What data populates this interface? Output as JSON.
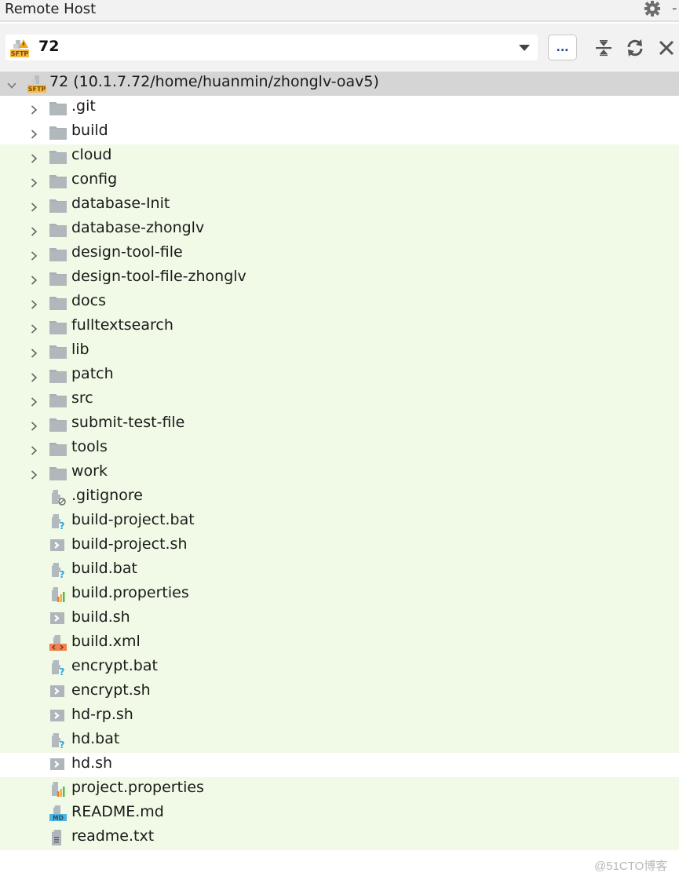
{
  "panel": {
    "title": "Remote Host",
    "settings_icon": "gear-icon",
    "more_icon": "more-icon"
  },
  "toolbar": {
    "connection_value": "72",
    "connection_icon": "sftp-warning-icon",
    "browse_label": "...",
    "collapse_icon": "collapse-all-icon",
    "refresh_icon": "refresh-icon",
    "close_icon": "close-icon"
  },
  "tree": {
    "root": {
      "label": "72 (10.1.7.72/home/huanmin/zhonglv-oav5)",
      "expanded": true,
      "icon": "sftp-icon"
    },
    "items": [
      {
        "label": ".git",
        "type": "folder",
        "icon": "folder-icon",
        "bg": "white"
      },
      {
        "label": "build",
        "type": "folder",
        "icon": "folder-icon",
        "bg": "white"
      },
      {
        "label": "cloud",
        "type": "folder",
        "icon": "folder-icon",
        "bg": "green"
      },
      {
        "label": "config",
        "type": "folder",
        "icon": "folder-icon",
        "bg": "green"
      },
      {
        "label": "database-Init",
        "type": "folder",
        "icon": "folder-icon",
        "bg": "green"
      },
      {
        "label": "database-zhonglv",
        "type": "folder",
        "icon": "folder-icon",
        "bg": "green"
      },
      {
        "label": "design-tool-file",
        "type": "folder",
        "icon": "folder-icon",
        "bg": "green"
      },
      {
        "label": "design-tool-file-zhonglv",
        "type": "folder",
        "icon": "folder-icon",
        "bg": "green"
      },
      {
        "label": "docs",
        "type": "folder",
        "icon": "folder-icon",
        "bg": "green"
      },
      {
        "label": "fulltextsearch",
        "type": "folder",
        "icon": "folder-icon",
        "bg": "green"
      },
      {
        "label": "lib",
        "type": "folder",
        "icon": "folder-icon",
        "bg": "green"
      },
      {
        "label": "patch",
        "type": "folder",
        "icon": "folder-icon",
        "bg": "green"
      },
      {
        "label": "src",
        "type": "folder",
        "icon": "folder-icon",
        "bg": "green"
      },
      {
        "label": "submit-test-file",
        "type": "folder",
        "icon": "folder-icon",
        "bg": "green"
      },
      {
        "label": "tools",
        "type": "folder",
        "icon": "folder-icon",
        "bg": "green"
      },
      {
        "label": "work",
        "type": "folder",
        "icon": "folder-icon",
        "bg": "green"
      },
      {
        "label": ".gitignore",
        "type": "file",
        "icon": "ignored-file-icon",
        "bg": "green"
      },
      {
        "label": "build-project.bat",
        "type": "file",
        "icon": "unknown-file-icon",
        "bg": "green"
      },
      {
        "label": "build-project.sh",
        "type": "file",
        "icon": "shell-script-icon",
        "bg": "green"
      },
      {
        "label": "build.bat",
        "type": "file",
        "icon": "unknown-file-icon",
        "bg": "green"
      },
      {
        "label": "build.properties",
        "type": "file",
        "icon": "properties-file-icon",
        "bg": "green"
      },
      {
        "label": "build.sh",
        "type": "file",
        "icon": "shell-script-icon",
        "bg": "green"
      },
      {
        "label": "build.xml",
        "type": "file",
        "icon": "xml-file-icon",
        "bg": "green"
      },
      {
        "label": "encrypt.bat",
        "type": "file",
        "icon": "unknown-file-icon",
        "bg": "green"
      },
      {
        "label": "encrypt.sh",
        "type": "file",
        "icon": "shell-script-icon",
        "bg": "green"
      },
      {
        "label": "hd-rp.sh",
        "type": "file",
        "icon": "shell-script-icon",
        "bg": "green"
      },
      {
        "label": "hd.bat",
        "type": "file",
        "icon": "unknown-file-icon",
        "bg": "green"
      },
      {
        "label": "hd.sh",
        "type": "file",
        "icon": "shell-script-icon",
        "bg": "white"
      },
      {
        "label": "project.properties",
        "type": "file",
        "icon": "properties-file-icon",
        "bg": "green"
      },
      {
        "label": "README.md",
        "type": "file",
        "icon": "markdown-file-icon",
        "bg": "green"
      },
      {
        "label": "readme.txt",
        "type": "file",
        "icon": "text-file-icon",
        "bg": "green"
      }
    ]
  },
  "colors": {
    "modified_row_bg": "#f0fae6",
    "root_row_bg": "#d5d5d5",
    "header_bg": "#f2f2f2",
    "folder_gray": "#a9b1b6",
    "sftp_orange": "#f5b942"
  },
  "watermark": "@51CTO博客"
}
